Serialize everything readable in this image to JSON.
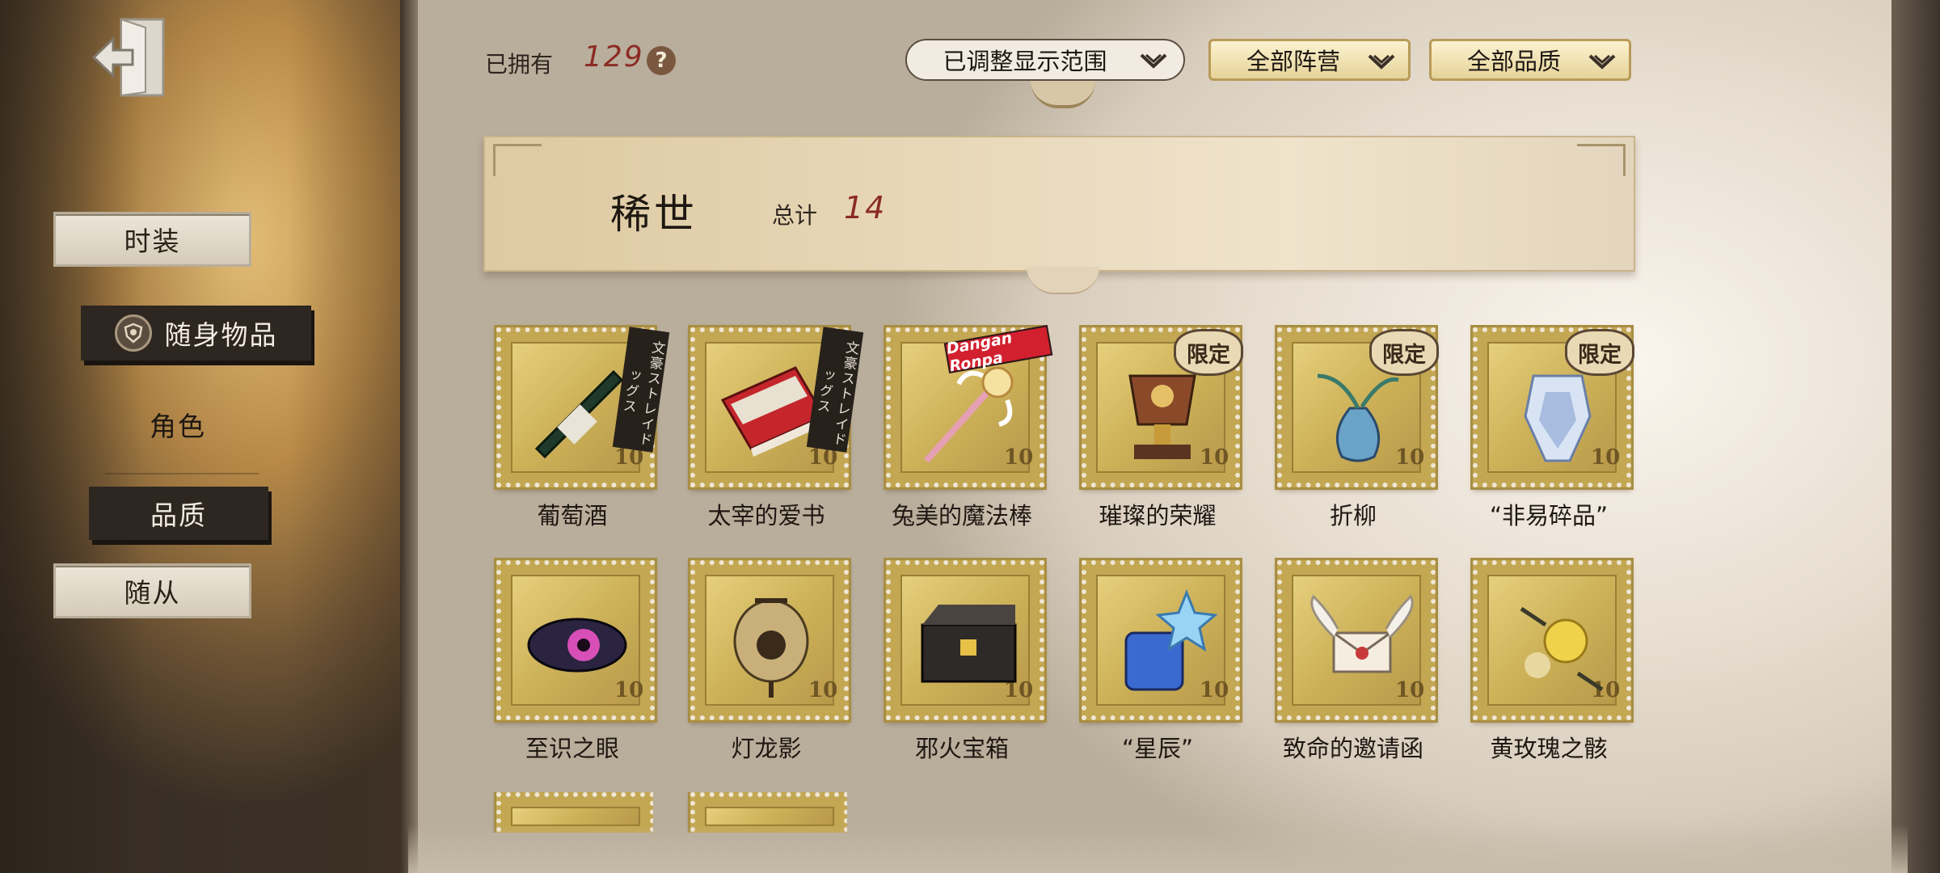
{
  "header": {
    "owned_label": "已拥有",
    "owned_count": "129",
    "help_icon": "?",
    "filters": [
      {
        "label": "已调整显示范围"
      },
      {
        "label": "全部阵营"
      },
      {
        "label": "全部品质"
      }
    ]
  },
  "sidebar": {
    "items": [
      {
        "label": "时装"
      },
      {
        "label": "随身物品"
      },
      {
        "label": "角色"
      },
      {
        "label": "品质"
      },
      {
        "label": "随从"
      }
    ]
  },
  "category": {
    "title": "稀世",
    "total_label": "总计",
    "total": "14"
  },
  "stamp_value": "10",
  "badges": {
    "limited": "限定",
    "collab_bungo": "文豪ストレイドッグス",
    "collab_danganronpa": "Dangan Ronpa"
  },
  "items": [
    {
      "name": "葡萄酒",
      "badge": "collab_bungo",
      "icon": "wine-bottle-icon"
    },
    {
      "name": "太宰的爱书",
      "badge": "collab_bungo",
      "icon": "red-book-icon"
    },
    {
      "name": "兔美的魔法棒",
      "badge": "collab_danganronpa",
      "icon": "magic-wand-icon"
    },
    {
      "name": "璀璨的荣耀",
      "badge": "limited",
      "icon": "trophy-icon"
    },
    {
      "name": "折柳",
      "badge": "limited",
      "icon": "willow-vase-icon"
    },
    {
      "name": "“非易碎品”",
      "badge": "limited",
      "icon": "crystal-vase-icon"
    },
    {
      "name": "至识之眼",
      "badge": "",
      "icon": "eye-icon"
    },
    {
      "name": "灯龙影",
      "badge": "",
      "icon": "lantern-icon"
    },
    {
      "name": "邪火宝箱",
      "badge": "",
      "icon": "chest-icon"
    },
    {
      "name": "“星辰”",
      "badge": "",
      "icon": "star-jar-icon"
    },
    {
      "name": "致命的邀请函",
      "badge": "",
      "icon": "winged-letter-icon"
    },
    {
      "name": "黄玫瑰之骸",
      "badge": "",
      "icon": "yellow-rose-icon"
    }
  ]
}
